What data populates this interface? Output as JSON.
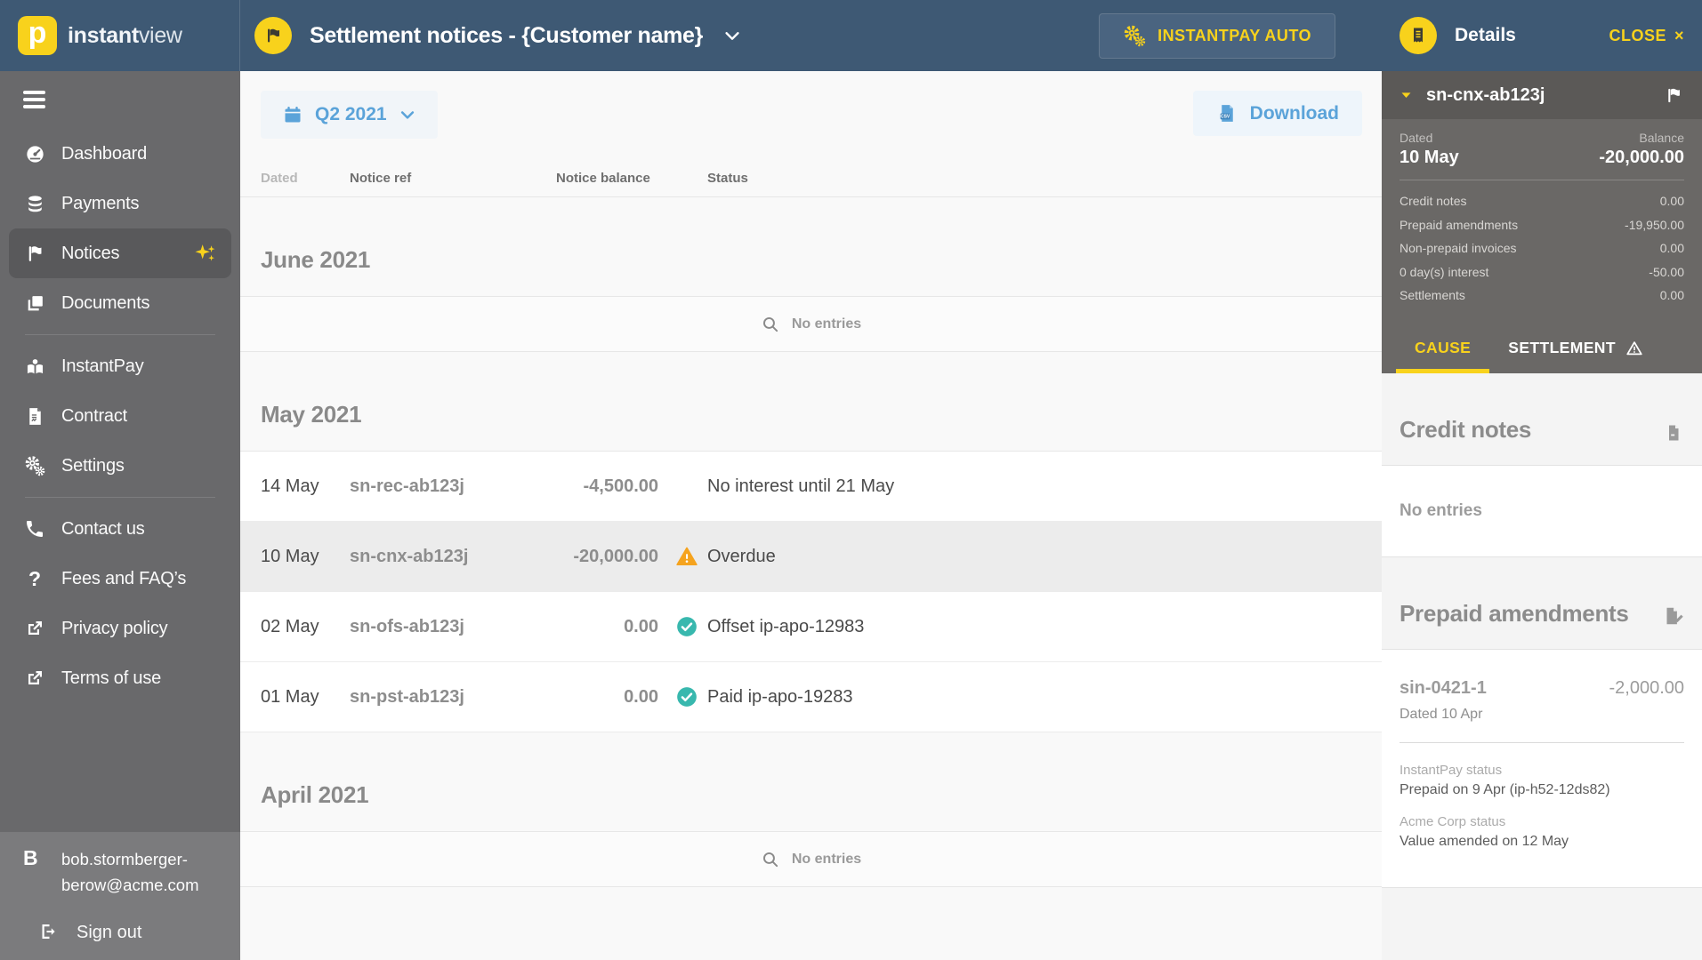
{
  "app": {
    "logo_letter": "p",
    "brand_bold": "instant",
    "brand_light": "view",
    "page_title": "Settlement notices - {Customer name}",
    "instantpay_auto_button": "INSTANTPAY AUTO"
  },
  "sidebar": {
    "items": [
      {
        "label": "Dashboard"
      },
      {
        "label": "Payments"
      },
      {
        "label": "Notices",
        "active": true
      },
      {
        "label": "Documents"
      },
      {
        "label": "InstantPay"
      },
      {
        "label": "Contract"
      },
      {
        "label": "Settings"
      },
      {
        "label": "Contact us"
      },
      {
        "label": "Fees and FAQ’s"
      },
      {
        "label": "Privacy policy"
      },
      {
        "label": "Terms of use"
      }
    ],
    "user": {
      "initial": "B",
      "email": "bob.stormberger-berow@acme.com"
    },
    "sign_out": "Sign out"
  },
  "toolbar": {
    "period": "Q2 2021",
    "download": "Download"
  },
  "table": {
    "columns": {
      "dated": "Dated",
      "ref": "Notice ref",
      "balance": "Notice balance",
      "status": "Status"
    },
    "sections": [
      {
        "month": "June 2021",
        "empty": true,
        "empty_label": "No entries"
      },
      {
        "month": "May 2021",
        "rows": [
          {
            "dated": "14 May",
            "ref": "sn-rec-ab123j",
            "balance": "-4,500.00",
            "status": "No interest until 21 May",
            "status_icon": "none",
            "selected": false
          },
          {
            "dated": "10 May",
            "ref": "sn-cnx-ab123j",
            "balance": "-20,000.00",
            "status": "Overdue",
            "status_icon": "warning",
            "selected": true
          },
          {
            "dated": "02 May",
            "ref": "sn-ofs-ab123j",
            "balance": "0.00",
            "status": "Offset ip-apo-12983",
            "status_icon": "check",
            "selected": false
          },
          {
            "dated": "01 May",
            "ref": "sn-pst-ab123j",
            "balance": "0.00",
            "status": "Paid ip-apo-19283",
            "status_icon": "check",
            "selected": false
          }
        ]
      },
      {
        "month": "April 2021",
        "empty": true,
        "empty_label": "No entries"
      }
    ]
  },
  "details": {
    "title": "Details",
    "close_label": "CLOSE",
    "notice_ref": "sn-cnx-ab123j",
    "dated_label": "Dated",
    "dated_value": "10 May",
    "balance_label": "Balance",
    "balance_value": "-20,000.00",
    "breakdown": [
      {
        "label": "Credit notes",
        "value": "0.00"
      },
      {
        "label": "Prepaid amendments",
        "value": "-19,950.00"
      },
      {
        "label": "Non-prepaid invoices",
        "value": "0.00"
      },
      {
        "label": "0 day(s) interest",
        "value": "-50.00"
      },
      {
        "label": "Settlements",
        "value": "0.00"
      }
    ],
    "tabs": [
      {
        "label": "CAUSE",
        "active": true
      },
      {
        "label": "SETTLEMENT",
        "warning": true
      }
    ],
    "credit_notes": {
      "heading": "Credit notes",
      "empty_label": "No entries"
    },
    "prepaid_amendments": {
      "heading": "Prepaid amendments",
      "entry": {
        "ref": "sin-0421-1",
        "amount": "-2,000.00",
        "dated": "Dated 10 Apr",
        "instantpay_status_label": "InstantPay status",
        "instantpay_status_value": "Prepaid on 9 Apr (ip-h52-12ds82)",
        "acme_status_label": "Acme Corp status",
        "acme_status_value": "Value amended on 12 May"
      }
    }
  },
  "colors": {
    "topbar_blue": "#3e5974",
    "accent_yellow": "#f8d21c",
    "accent_blue": "#5ba3d9",
    "warning_orange": "#f5a31e",
    "success_teal": "#38b8ae",
    "sidebar_gray": "#69696b",
    "panel_dark_gray": "#6a6866"
  }
}
